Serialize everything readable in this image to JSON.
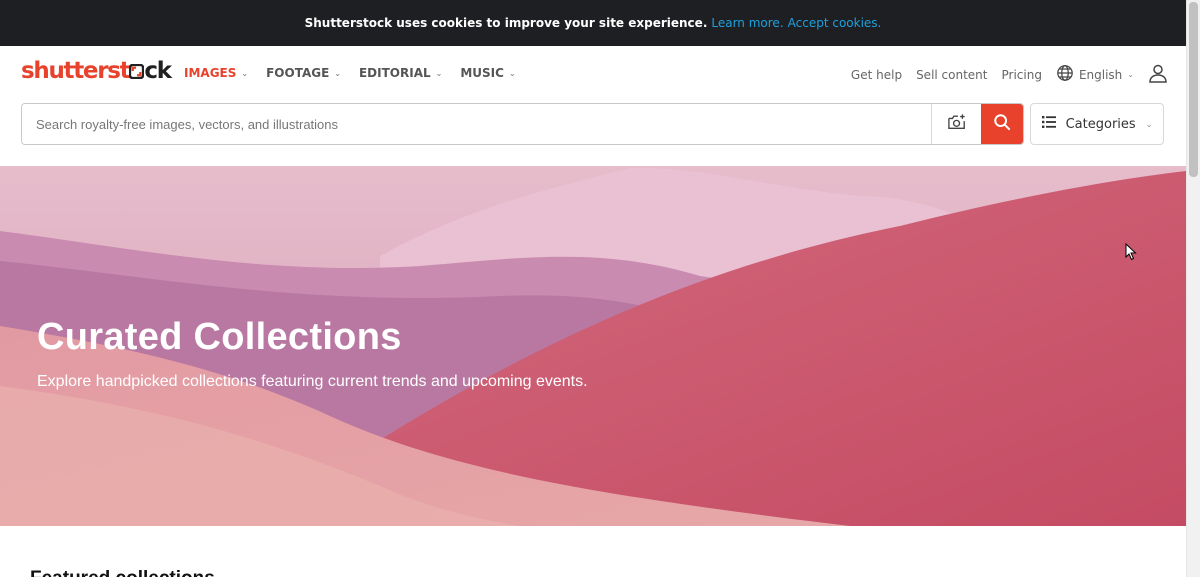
{
  "cookie_banner": {
    "message": "Shutterstock uses cookies to improve your site experience.",
    "learn_more": "Learn more.",
    "accept": "Accept cookies."
  },
  "header": {
    "logo_part1": "shutterst",
    "logo_part2": "ck",
    "nav": [
      {
        "label": "IMAGES",
        "active": true
      },
      {
        "label": "FOOTAGE",
        "active": false
      },
      {
        "label": "EDITORIAL",
        "active": false
      },
      {
        "label": "MUSIC",
        "active": false
      }
    ],
    "get_help": "Get help",
    "sell_content": "Sell content",
    "pricing": "Pricing",
    "language": "English"
  },
  "search": {
    "placeholder": "Search royalty-free images, vectors, and illustrations",
    "categories_label": "Categories"
  },
  "hero": {
    "title": "Curated Collections",
    "subtitle": "Explore handpicked collections featuring current trends and upcoming events."
  },
  "section": {
    "featured_title": "Featured collections"
  },
  "colors": {
    "brand": "#e8412c",
    "link": "#1ea0de",
    "banner_bg": "#1d1f22"
  }
}
